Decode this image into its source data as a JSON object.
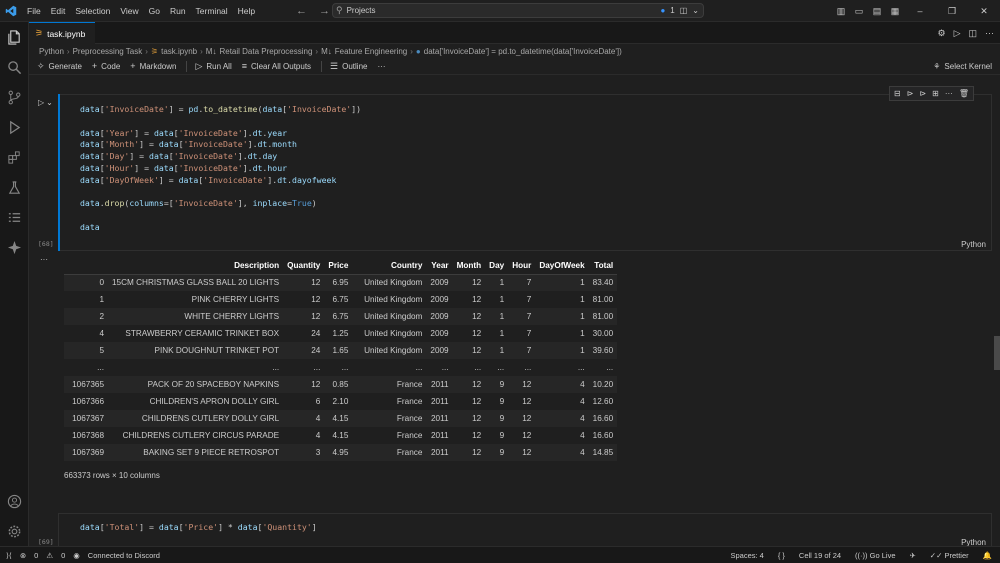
{
  "menu": [
    "File",
    "Edit",
    "Selection",
    "View",
    "Go",
    "Run",
    "Terminal",
    "Help"
  ],
  "search": {
    "text": "Projects",
    "badge": "1"
  },
  "tab": {
    "label": "task.ipynb"
  },
  "breadcrumb": [
    "Python",
    "Preprocessing Task",
    "task.ipynb",
    "Retail Data Preprocessing",
    "Feature Engineering",
    "data['InvoiceDate'] = pd.to_datetime(data['InvoiceDate'])"
  ],
  "toolbar": {
    "generate": "Generate",
    "code": "Code",
    "markdown": "Markdown",
    "run_all": "Run All",
    "clear_all": "Clear All Outputs",
    "outline": "Outline",
    "more": "···",
    "select_kernel": "Select Kernel"
  },
  "cell1": {
    "exec_count": "[68]",
    "language": "Python"
  },
  "cell2": {
    "exec_count": "[69]",
    "language": "Python",
    "code": "data['Total'] = data['Price'] * data['Quantity']"
  },
  "dataframe": {
    "columns": [
      "",
      "Description",
      "Quantity",
      "Price",
      "Country",
      "Year",
      "Month",
      "Day",
      "Hour",
      "DayOfWeek",
      "Total"
    ],
    "rows": [
      [
        "0",
        "15CM CHRISTMAS GLASS BALL 20 LIGHTS",
        "12",
        "6.95",
        "United Kingdom",
        "2009",
        "12",
        "1",
        "7",
        "1",
        "83.40"
      ],
      [
        "1",
        "PINK CHERRY LIGHTS",
        "12",
        "6.75",
        "United Kingdom",
        "2009",
        "12",
        "1",
        "7",
        "1",
        "81.00"
      ],
      [
        "2",
        "WHITE CHERRY LIGHTS",
        "12",
        "6.75",
        "United Kingdom",
        "2009",
        "12",
        "1",
        "7",
        "1",
        "81.00"
      ],
      [
        "4",
        "STRAWBERRY CERAMIC TRINKET BOX",
        "24",
        "1.25",
        "United Kingdom",
        "2009",
        "12",
        "1",
        "7",
        "1",
        "30.00"
      ],
      [
        "5",
        "PINK DOUGHNUT TRINKET POT",
        "24",
        "1.65",
        "United Kingdom",
        "2009",
        "12",
        "1",
        "7",
        "1",
        "39.60"
      ],
      [
        "...",
        "...",
        "...",
        "...",
        "...",
        "...",
        "...",
        "...",
        "...",
        "...",
        "..."
      ],
      [
        "1067365",
        "PACK OF 20 SPACEBOY NAPKINS",
        "12",
        "0.85",
        "France",
        "2011",
        "12",
        "9",
        "12",
        "4",
        "10.20"
      ],
      [
        "1067366",
        "CHILDREN'S APRON DOLLY GIRL",
        "6",
        "2.10",
        "France",
        "2011",
        "12",
        "9",
        "12",
        "4",
        "12.60"
      ],
      [
        "1067367",
        "CHILDRENS CUTLERY DOLLY GIRL",
        "4",
        "4.15",
        "France",
        "2011",
        "12",
        "9",
        "12",
        "4",
        "16.60"
      ],
      [
        "1067368",
        "CHILDRENS CUTLERY CIRCUS PARADE",
        "4",
        "4.15",
        "France",
        "2011",
        "12",
        "9",
        "12",
        "4",
        "16.60"
      ],
      [
        "1067369",
        "BAKING SET 9 PIECE RETROSPOT",
        "3",
        "4.95",
        "France",
        "2011",
        "12",
        "9",
        "12",
        "4",
        "14.85"
      ]
    ],
    "shape": "663373 rows × 10 columns"
  },
  "status": {
    "errors": "0",
    "warnings": "0",
    "discord": "Connected to Discord",
    "spaces": "Spaces: 4",
    "braces": "{ }",
    "cell": "Cell 19 of 24",
    "golive": "Go Live",
    "prettier": "Prettier"
  }
}
